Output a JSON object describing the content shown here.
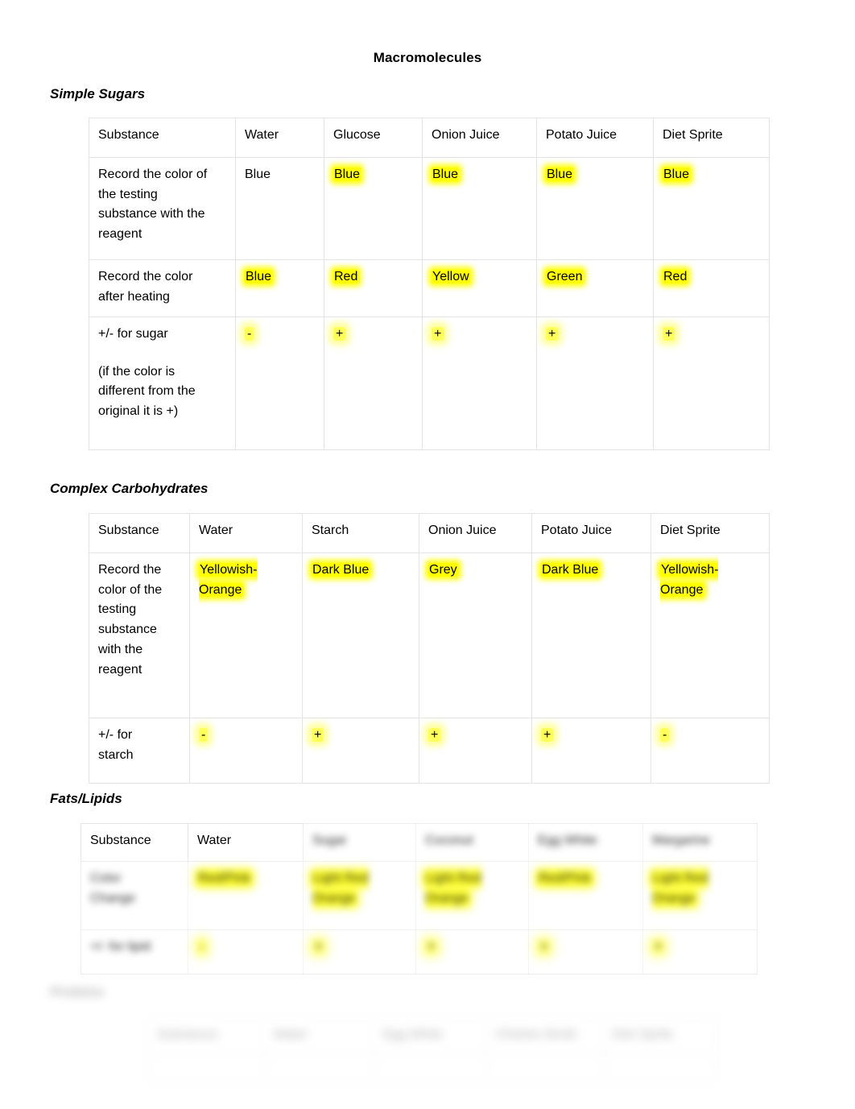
{
  "document": {
    "title": "Macromolecules"
  },
  "sections": {
    "simple_sugars": {
      "heading": "Simple Sugars",
      "columns": [
        "Substance",
        "Water",
        "Glucose",
        "Onion Juice",
        "Potato Juice",
        "Diet Sprite"
      ],
      "rows": [
        {
          "label_lines": [
            "Record the color of",
            "the testing",
            "substance with the",
            "reagent"
          ],
          "cells": [
            {
              "text": "Blue",
              "highlighted": false
            },
            {
              "text": "Blue",
              "highlighted": true
            },
            {
              "text": "Blue",
              "highlighted": true
            },
            {
              "text": "Blue",
              "highlighted": true
            },
            {
              "text": "Blue",
              "highlighted": true
            }
          ]
        },
        {
          "label_lines": [
            "Record the color",
            "after heating"
          ],
          "cells": [
            {
              "text": "Blue",
              "highlighted": true
            },
            {
              "text": "Red",
              "highlighted": true
            },
            {
              "text": "Yellow",
              "highlighted": true
            },
            {
              "text": "Green",
              "highlighted": true
            },
            {
              "text": "Red",
              "highlighted": true
            }
          ]
        },
        {
          "label_lines": [
            "+/- for sugar",
            "",
            "(if the color is",
            "different from the",
            "original it is +)"
          ],
          "cells": [
            {
              "text": "-",
              "highlighted": true
            },
            {
              "text": "+",
              "highlighted": true
            },
            {
              "text": "+",
              "highlighted": true
            },
            {
              "text": "+",
              "highlighted": true
            },
            {
              "text": "+",
              "highlighted": true
            }
          ]
        }
      ]
    },
    "complex_carbohydrates": {
      "heading": "Complex Carbohydrates",
      "columns": [
        "Substance",
        "Water",
        "Starch",
        "Onion Juice",
        "Potato Juice",
        "Diet Sprite"
      ],
      "rows": [
        {
          "label_lines": [
            "Record the",
            "color of the",
            "testing",
            "substance",
            "with the",
            "reagent"
          ],
          "cells": [
            {
              "text": "Yellowish-Orange",
              "highlighted": true
            },
            {
              "text": "Dark Blue",
              "highlighted": true
            },
            {
              "text": "Grey",
              "highlighted": true
            },
            {
              "text": "Dark Blue",
              "highlighted": true
            },
            {
              "text": "Yellowish-Orange",
              "highlighted": true
            }
          ]
        },
        {
          "label_lines": [
            "+/- for",
            "starch"
          ],
          "cells": [
            {
              "text": "-",
              "highlighted": true
            },
            {
              "text": "+",
              "highlighted": true
            },
            {
              "text": "+",
              "highlighted": true
            },
            {
              "text": "+",
              "highlighted": true
            },
            {
              "text": "-",
              "highlighted": true
            }
          ]
        }
      ]
    },
    "fats_lipids": {
      "heading": "Fats/Lipids",
      "columns": [
        "Substance",
        "Water",
        "Sugar",
        "Coconut",
        "Egg White",
        "Margarine"
      ],
      "rows": [
        {
          "label_lines": [
            "Color",
            "Change"
          ],
          "cells": [
            {
              "text": "Red/Pink",
              "highlighted": true
            },
            {
              "text": "Light Red Orange",
              "highlighted": true
            },
            {
              "text": "Light Red Orange",
              "highlighted": true
            },
            {
              "text": "Red/Pink",
              "highlighted": true
            },
            {
              "text": "Light Red Orange",
              "highlighted": true
            }
          ]
        },
        {
          "label_lines": [
            "+/- for lipid"
          ],
          "cells": [
            {
              "text": "-",
              "highlighted": true
            },
            {
              "text": "+",
              "highlighted": true
            },
            {
              "text": "+",
              "highlighted": true
            },
            {
              "text": "+",
              "highlighted": true
            },
            {
              "text": "+",
              "highlighted": true
            }
          ]
        }
      ]
    },
    "proteins": {
      "heading": "Proteins",
      "columns": [
        "Substance",
        "Water",
        "Egg White",
        "Chicken Broth",
        "Diet Sprite"
      ],
      "rows": [
        {
          "label_lines": [
            ""
          ],
          "cells": [
            {
              "text": "",
              "highlighted": false
            },
            {
              "text": "",
              "highlighted": false
            },
            {
              "text": "",
              "highlighted": false
            },
            {
              "text": "",
              "highlighted": false
            }
          ]
        }
      ]
    }
  },
  "colors": {
    "highlight": "#ffff00",
    "text": "#000000",
    "table_border": "#e4e4e4",
    "page_background": "#ffffff"
  }
}
